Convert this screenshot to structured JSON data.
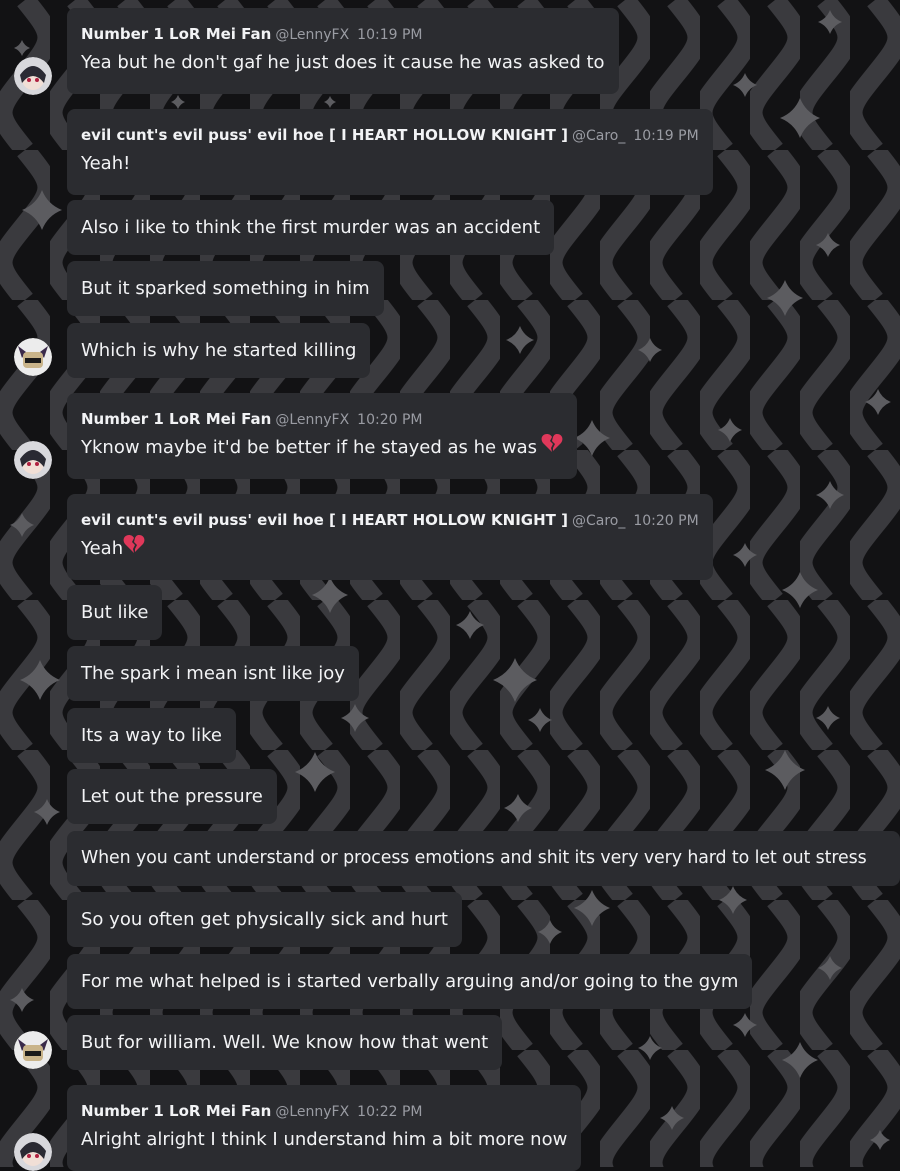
{
  "colors": {
    "background": "#121214",
    "wave": "#3a3a3e",
    "sparkle": "#5c5c60",
    "bubble": "#2b2c30",
    "text": "#f2f3f5",
    "muted": "#9a9ca3",
    "heart": "#e0385a"
  },
  "icons": {
    "broken_heart": "broken-heart-icon",
    "avatar_lenny": "avatar-lenny",
    "avatar_caro": "avatar-caro"
  },
  "messages": [
    {
      "user": "Number 1 LoR Mei Fan",
      "handle": "@LennyFX",
      "time": "10:19 PM",
      "text": "Yea but he don't gaf he just does it cause he was asked to"
    },
    {
      "user": "evil cunt's evil puss' evil hoe [ I HEART HOLLOW KNIGHT ]",
      "handle": "@Caro_",
      "time": "10:19 PM",
      "text": "Yeah!"
    },
    {
      "text": "Also i like to think the first murder was an accident"
    },
    {
      "text": "But it sparked something in him"
    },
    {
      "text": "Which is why he started killing"
    },
    {
      "user": "Number 1 LoR Mei Fan",
      "handle": "@LennyFX",
      "time": "10:20 PM",
      "text": "Yknow maybe it'd be better if he stayed as he was"
    },
    {
      "user": "evil cunt's evil puss' evil hoe [ I HEART HOLLOW KNIGHT ]",
      "handle": "@Caro_",
      "time": "10:20 PM",
      "text": "Yeah"
    },
    {
      "text": "But like"
    },
    {
      "text": "The spark i mean isnt like joy"
    },
    {
      "text": "Its a way to like"
    },
    {
      "text": "Let out the pressure"
    },
    {
      "text": "When you cant understand or process emotions and shit its very very hard to let out stress"
    },
    {
      "text": "So you often get physically sick and hurt"
    },
    {
      "text": "For me what helped is i started verbally arguing and/or going to the gym"
    },
    {
      "text": "But for william. Well. We know how that went"
    },
    {
      "user": "Number 1 LoR Mei Fan",
      "handle": "@LennyFX",
      "time": "10:22 PM",
      "text": "Alright alright I think I understand him a bit more now"
    }
  ]
}
